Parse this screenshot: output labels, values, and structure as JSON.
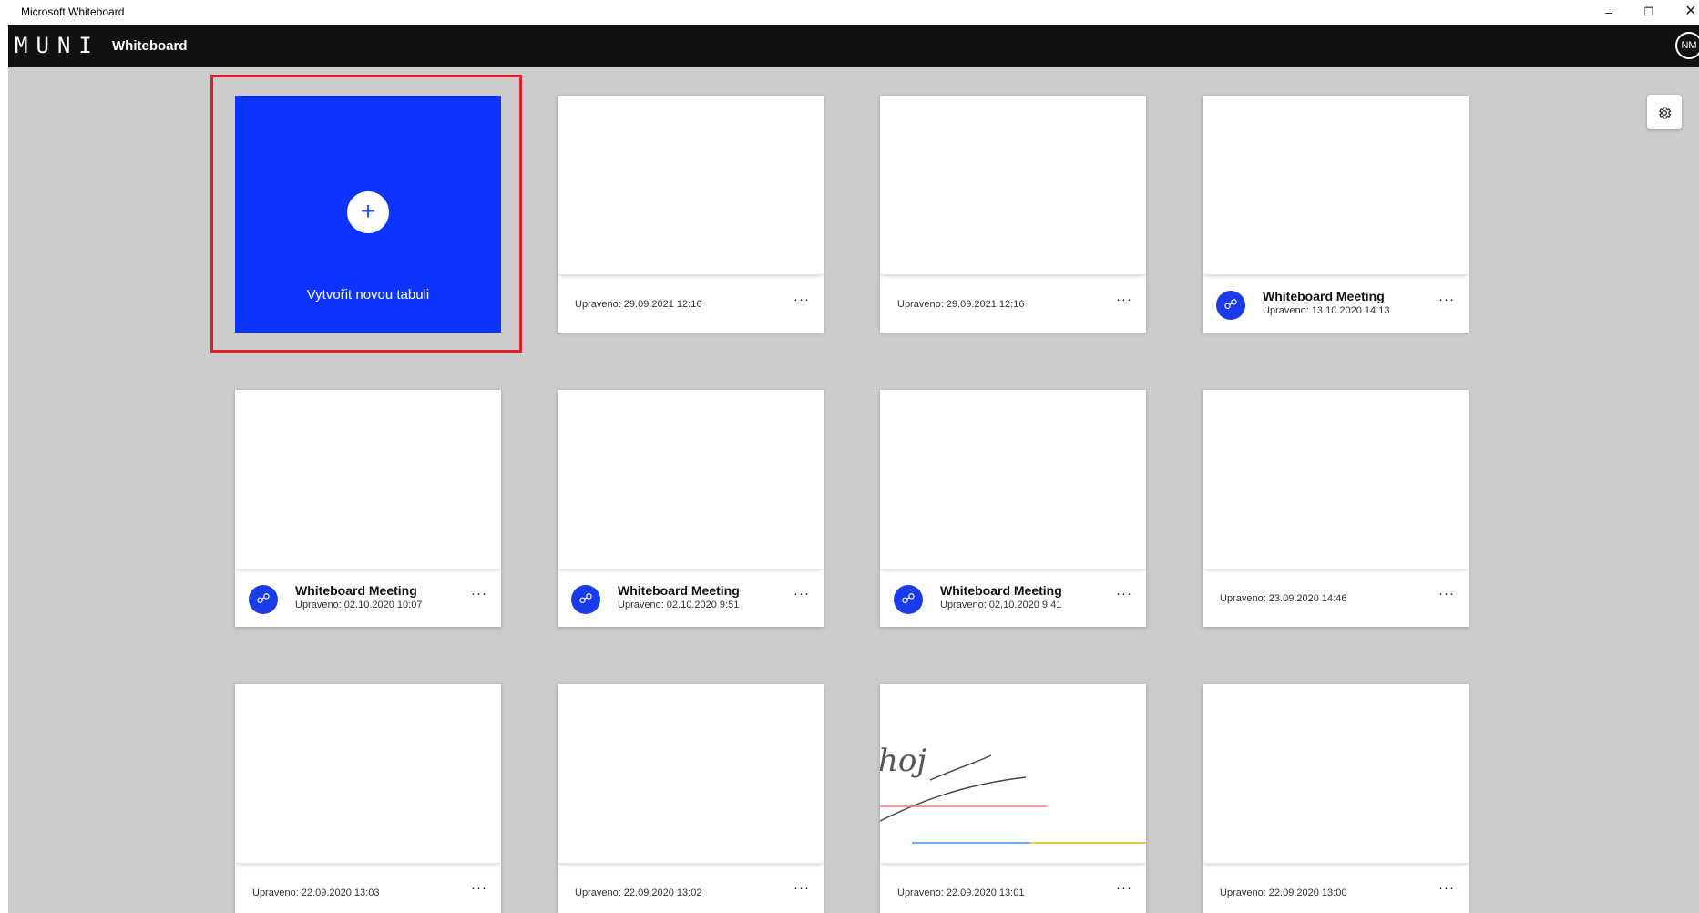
{
  "window": {
    "title": "Microsoft Whiteboard",
    "minimize_glyph": "–",
    "restore_glyph": "❐",
    "close_glyph": "✕"
  },
  "header": {
    "logo": "MUNI",
    "app_name": "Whiteboard",
    "avatar_initials": "NM"
  },
  "settings_icon": "gear-icon",
  "new_board": {
    "plus": "+",
    "label": "Vytvořit novou tabuli"
  },
  "colors": {
    "accent": "#0d34ff",
    "meeting_icon": "#1a3be8",
    "highlight_border": "#e31d2b",
    "background": "#cccccc",
    "header": "#111111"
  },
  "more_glyph": "···",
  "meeting_icon_glyph": "☍",
  "boards": [
    {
      "title": "",
      "date": "Upraveno: 29.09.2021 12:16",
      "meeting": false
    },
    {
      "title": "",
      "date": "Upraveno: 29.09.2021 12:16",
      "meeting": false
    },
    {
      "title": "Whiteboard Meeting",
      "date": "Upraveno: 13.10.2020 14:13",
      "meeting": true
    },
    {
      "title": "Whiteboard Meeting",
      "date": "Upraveno: 02.10.2020 10:07",
      "meeting": true
    },
    {
      "title": "Whiteboard Meeting",
      "date": "Upraveno: 02.10.2020 9:51",
      "meeting": true
    },
    {
      "title": "Whiteboard Meeting",
      "date": "Upraveno: 02.10.2020 9:41",
      "meeting": true
    },
    {
      "title": "",
      "date": "Upraveno: 23.09.2020 14:46",
      "meeting": false
    },
    {
      "title": "",
      "date": "Upraveno: 22.09.2020 13:03",
      "meeting": false
    },
    {
      "title": "",
      "date": "Upraveno: 22.09.2020 13:02",
      "meeting": false
    },
    {
      "title": "",
      "date": "Upraveno: 22.09.2020 13:01",
      "meeting": false,
      "sketch_text": "hoj"
    },
    {
      "title": "",
      "date": "Upraveno: 22.09.2020 13:00",
      "meeting": false
    }
  ]
}
